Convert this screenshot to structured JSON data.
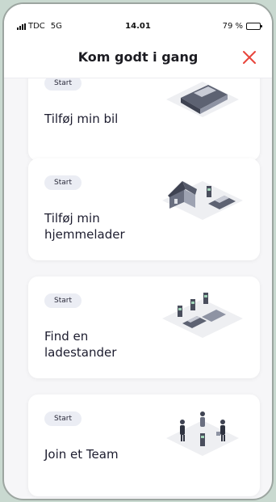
{
  "status": {
    "carrier": "TDC",
    "network": "5G",
    "time": "14.01",
    "battery": "79 %"
  },
  "header": {
    "title": "Kom godt i gang"
  },
  "cards": [
    {
      "badge": "Start",
      "title": "Tilføj min bil",
      "illustration": "car-illustration"
    },
    {
      "badge": "Start",
      "title": "Tilføj min hjemmelader",
      "illustration": "home-charger-illustration"
    },
    {
      "badge": "Start",
      "title": "Find en ladestander",
      "illustration": "charging-stations-illustration"
    },
    {
      "badge": "Start",
      "title": "Join et Team",
      "illustration": "team-illustration"
    }
  ],
  "colors": {
    "close_icon": "#e8453c",
    "badge_bg": "#ebedf4",
    "outer_bg": "#c9d9d0"
  }
}
